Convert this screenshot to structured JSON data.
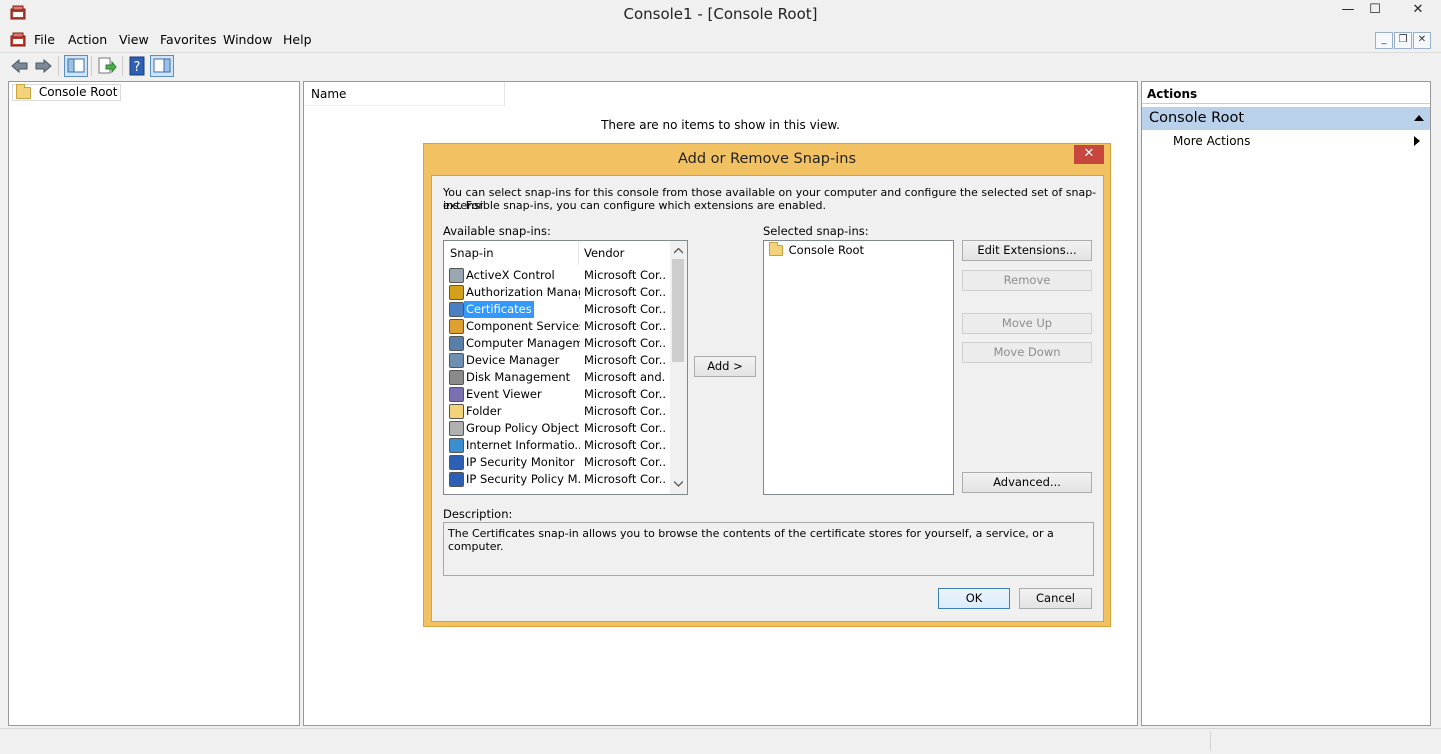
{
  "window": {
    "title": "Console1 - [Console Root]",
    "minimize": "—",
    "maximize": "☐",
    "close": "✕"
  },
  "menu": {
    "items": [
      "File",
      "Action",
      "View",
      "Favorites",
      "Window",
      "Help"
    ],
    "mdi_minimize": "_",
    "mdi_restore": "❐",
    "mdi_close": "✕"
  },
  "toolbar": {
    "icons": [
      "back-icon",
      "forward-icon",
      "show-hide-console-tree-icon",
      "export-list-icon",
      "help-icon",
      "show-hide-action-pane-icon"
    ]
  },
  "tree": {
    "root_label": "Console Root"
  },
  "center": {
    "column_name": "Name",
    "empty_message": "There are no items to show in this view."
  },
  "actions": {
    "header": "Actions",
    "section_title": "Console Root",
    "more_actions": "More Actions"
  },
  "dialog": {
    "title": "Add or Remove Snap-ins",
    "close": "✕",
    "intro_line1": "You can select snap-ins for this console from those available on your computer and configure the selected set of snap-ins. For",
    "intro_line2": "extensible snap-ins, you can configure which extensions are enabled.",
    "available_label": "Available snap-ins:",
    "selected_label": "Selected snap-ins:",
    "col_snapin": "Snap-in",
    "col_vendor": "Vendor",
    "snapins": [
      {
        "name": "ActiveX Control",
        "vendor": "Microsoft Cor...",
        "icon": "activex-icon"
      },
      {
        "name": "Authorization Manager",
        "vendor": "Microsoft Cor...",
        "icon": "authorization-manager-icon"
      },
      {
        "name": "Certificates",
        "vendor": "Microsoft Cor...",
        "icon": "certificates-icon",
        "selected": true
      },
      {
        "name": "Component Services",
        "vendor": "Microsoft Cor...",
        "icon": "component-services-icon"
      },
      {
        "name": "Computer Managem...",
        "vendor": "Microsoft Cor...",
        "icon": "computer-management-icon"
      },
      {
        "name": "Device Manager",
        "vendor": "Microsoft Cor...",
        "icon": "device-manager-icon"
      },
      {
        "name": "Disk Management",
        "vendor": "Microsoft and...",
        "icon": "disk-management-icon"
      },
      {
        "name": "Event Viewer",
        "vendor": "Microsoft Cor...",
        "icon": "event-viewer-icon"
      },
      {
        "name": "Folder",
        "vendor": "Microsoft Cor...",
        "icon": "folder-icon"
      },
      {
        "name": "Group Policy Object ...",
        "vendor": "Microsoft Cor...",
        "icon": "group-policy-icon"
      },
      {
        "name": "Internet Informatio...",
        "vendor": "Microsoft Cor...",
        "icon": "iis-icon"
      },
      {
        "name": "IP Security Monitor",
        "vendor": "Microsoft Cor...",
        "icon": "ip-security-monitor-icon"
      },
      {
        "name": "IP Security Policy M...",
        "vendor": "Microsoft Cor...",
        "icon": "ip-security-policy-icon"
      }
    ],
    "add_button": "Add >",
    "selected_root": "Console Root",
    "edit_extensions": "Edit Extensions...",
    "remove": "Remove",
    "move_up": "Move Up",
    "move_down": "Move Down",
    "advanced": "Advanced...",
    "description_label": "Description:",
    "description_text": "The Certificates snap-in allows you to browse the contents of the certificate stores for yourself, a service, or a computer.",
    "ok": "OK",
    "cancel": "Cancel"
  },
  "colors": {
    "dialog_frame": "#f2c262",
    "dialog_close": "#c7463e",
    "selection": "#3399ff",
    "actions_section": "#b9d1ea"
  }
}
